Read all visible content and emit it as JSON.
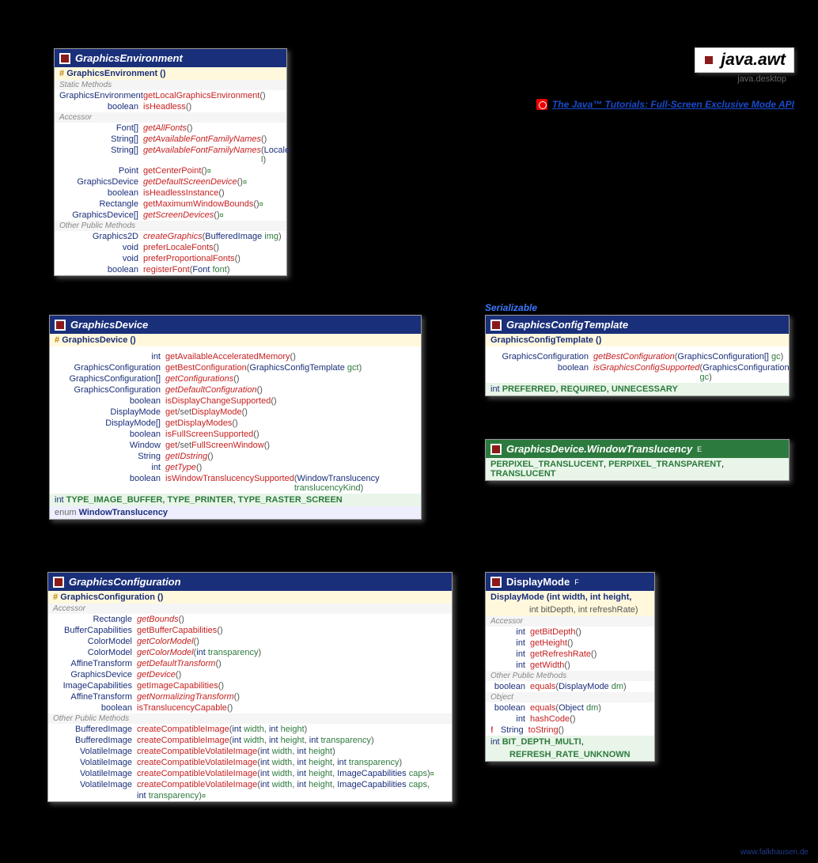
{
  "package": {
    "name": "java.awt",
    "module": "java.desktop"
  },
  "tutorial": "The Java™ Tutorials: Full-Screen Exclusive Mode API",
  "footer": "www.falkhausen.de",
  "stereotype": "Serializable",
  "labels": {
    "static": "Static Methods",
    "accessor": "Accessor",
    "other": "Other Public Methods",
    "object": "Object"
  },
  "ge": {
    "title": "GraphicsEnvironment",
    "ctor": "GraphicsEnvironment ()",
    "static": [
      {
        "ret": "GraphicsEnvironment",
        "name": "getLocalGraphicsEnvironment",
        "params": "()"
      },
      {
        "ret": "boolean",
        "name": "isHeadless",
        "params": "()"
      }
    ],
    "accessor": [
      {
        "ret": "Font[]",
        "name": "getAllFonts",
        "params": "()",
        "it": true
      },
      {
        "ret": "String[]",
        "name": "getAvailableFontFamilyNames",
        "params": "()",
        "it": true
      },
      {
        "ret": "String[]",
        "name": "getAvailableFontFamilyNames",
        "paramsHtml": true,
        "ptype": "Locale",
        "pname": "l",
        "it": true
      },
      {
        "ret": "Point",
        "name": "getCenterPoint",
        "params": "()",
        "tail": " ¤"
      },
      {
        "ret": "GraphicsDevice",
        "name": "getDefaultScreenDevice",
        "params": "()",
        "it": true,
        "tail": " ¤"
      },
      {
        "ret": "boolean",
        "name": "isHeadlessInstance",
        "params": "()"
      },
      {
        "ret": "Rectangle",
        "name": "getMaximumWindowBounds",
        "params": "()",
        "tail": " ¤"
      },
      {
        "ret": "GraphicsDevice[]",
        "name": "getScreenDevices",
        "params": "()",
        "it": true,
        "tail": " ¤"
      }
    ],
    "other": [
      {
        "ret": "Graphics2D",
        "name": "createGraphics",
        "ptype": "BufferedImage",
        "pname": "img",
        "it": true
      },
      {
        "ret": "void",
        "name": "preferLocaleFonts",
        "params": "()"
      },
      {
        "ret": "void",
        "name": "preferProportionalFonts",
        "params": "()"
      },
      {
        "ret": "boolean",
        "name": "registerFont",
        "ptype": "Font",
        "pname": "font"
      }
    ]
  },
  "gd": {
    "title": "GraphicsDevice",
    "ctor": "GraphicsDevice ()",
    "methods": [
      {
        "ret": "int",
        "name": "getAvailableAcceleratedMemory",
        "params": "()"
      },
      {
        "ret": "GraphicsConfiguration",
        "name": "getBestConfiguration",
        "ptype": "GraphicsConfigTemplate",
        "pname": "gct"
      },
      {
        "ret": "GraphicsConfiguration[]",
        "name": "getConfigurations",
        "params": "()",
        "it": true
      },
      {
        "ret": "GraphicsConfiguration",
        "name": "getDefaultConfiguration",
        "params": "()",
        "it": true
      },
      {
        "ret": "boolean",
        "name": "isDisplayChangeSupported",
        "params": "()"
      },
      {
        "ret": "DisplayMode",
        "namePrefix": "get",
        "nameSlash": "/set",
        "nameSuffix": "DisplayMode",
        "params": "()"
      },
      {
        "ret": "DisplayMode[]",
        "name": "getDisplayModes",
        "params": "()"
      },
      {
        "ret": "boolean",
        "name": "isFullScreenSupported",
        "params": "()"
      },
      {
        "ret": "Window",
        "namePrefix": "get",
        "nameSlash": "/set",
        "nameSuffix": "FullScreenWindow",
        "params": "()"
      },
      {
        "ret": "String",
        "name": "getIDstring",
        "params": "()",
        "it": true
      },
      {
        "ret": "int",
        "name": "getType",
        "params": "()",
        "it": true
      },
      {
        "ret": "boolean",
        "name": "isWindowTranslucencySupported",
        "ptype": "WindowTranslucency",
        "pname": "translucencyKind"
      }
    ],
    "consts": "int TYPE_IMAGE_BUFFER, TYPE_PRINTER, TYPE_RASTER_SCREEN",
    "inner": "enum WindowTranslucency"
  },
  "gct": {
    "title": "GraphicsConfigTemplate",
    "ctor": "GraphicsConfigTemplate ()",
    "methods": [
      {
        "ret": "GraphicsConfiguration",
        "name": "getBestConfiguration",
        "it": true,
        "ptype": "GraphicsConfiguration[]",
        "pname": "gc"
      },
      {
        "ret": "boolean",
        "name": "isGraphicsConfigSupported",
        "it": true,
        "ptype": "GraphicsConfiguration",
        "pname": "gc"
      }
    ],
    "consts": "int PREFERRED, REQUIRED, UNNECESSARY"
  },
  "wt": {
    "title": "GraphicsDevice.WindowTranslucency",
    "super": "E",
    "consts": "PERPIXEL_TRANSLUCENT, PERPIXEL_TRANSPARENT, TRANSLUCENT"
  },
  "gc": {
    "title": "GraphicsConfiguration",
    "ctor": "GraphicsConfiguration ()",
    "accessor": [
      {
        "ret": "Rectangle",
        "name": "getBounds",
        "params": "()",
        "it": true
      },
      {
        "ret": "BufferCapabilities",
        "name": "getBufferCapabilities",
        "params": "()"
      },
      {
        "ret": "ColorModel",
        "name": "getColorModel",
        "params": "()",
        "it": true
      },
      {
        "ret": "ColorModel",
        "name": "getColorModel",
        "it": true,
        "ptype": "int",
        "pname": "transparency"
      },
      {
        "ret": "AffineTransform",
        "name": "getDefaultTransform",
        "params": "()",
        "it": true
      },
      {
        "ret": "GraphicsDevice",
        "name": "getDevice",
        "params": "()",
        "it": true
      },
      {
        "ret": "ImageCapabilities",
        "name": "getImageCapabilities",
        "params": "()"
      },
      {
        "ret": "AffineTransform",
        "name": "getNormalizingTransform",
        "params": "()",
        "it": true
      },
      {
        "ret": "boolean",
        "name": "isTranslucencyCapable",
        "params": "()"
      }
    ],
    "other": [
      {
        "ret": "BufferedImage",
        "name": "createCompatibleImage",
        "plain": "(int width, int height)"
      },
      {
        "ret": "BufferedImage",
        "name": "createCompatibleImage",
        "plain": "(int width, int height, int transparency)"
      },
      {
        "ret": "VolatileImage",
        "name": "createCompatibleVolatileImage",
        "plain": "(int width, int height)"
      },
      {
        "ret": "VolatileImage",
        "name": "createCompatibleVolatileImage",
        "plain": "(int width, int height, int transparency)"
      },
      {
        "ret": "VolatileImage",
        "name": "createCompatibleVolatileImage",
        "plain": "(int width, int height, ImageCapabilities caps)",
        "tail": " ¤"
      },
      {
        "ret": "VolatileImage",
        "name": "createCompatibleVolatileImage",
        "plain": "(int width, int height, ImageCapabilities caps,",
        "tail": ""
      },
      {
        "ret": "",
        "name": "",
        "plain": "                                    int transparency)",
        "tail": " ¤",
        "cont": true
      }
    ]
  },
  "dm": {
    "title": "DisplayMode",
    "super": "F",
    "ctorLines": [
      "DisplayMode (int width, int height,",
      "int bitDepth, int refreshRate)"
    ],
    "accessor": [
      {
        "ret": "int",
        "name": "getBitDepth",
        "params": "()"
      },
      {
        "ret": "int",
        "name": "getHeight",
        "params": "()"
      },
      {
        "ret": "int",
        "name": "getRefreshRate",
        "params": "()"
      },
      {
        "ret": "int",
        "name": "getWidth",
        "params": "()"
      }
    ],
    "other": [
      {
        "ret": "boolean",
        "name": "equals",
        "ptype": "DisplayMode",
        "pname": "dm"
      }
    ],
    "object": [
      {
        "ret": "boolean",
        "name": "equals",
        "ptype": "Object",
        "pname": "dm"
      },
      {
        "ret": "int",
        "name": "hashCode",
        "params": "()"
      },
      {
        "ret": "String",
        "name": "toString",
        "params": "()",
        "excl": true
      }
    ],
    "consts": [
      "int BIT_DEPTH_MULTI,",
      "REFRESH_RATE_UNKNOWN"
    ]
  }
}
